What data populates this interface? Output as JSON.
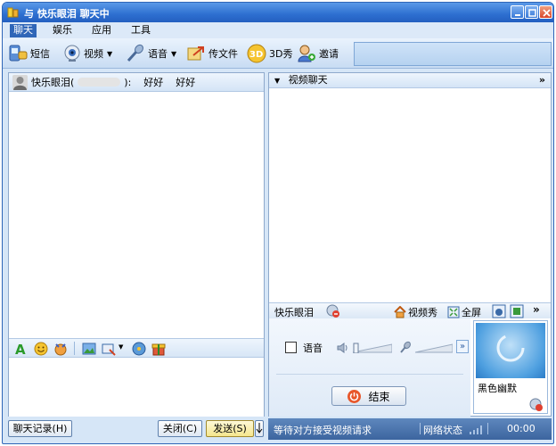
{
  "window": {
    "title": "与  快乐眼泪  聊天中"
  },
  "menu": [
    {
      "label": "聊天",
      "active": true
    },
    {
      "label": "娱乐"
    },
    {
      "label": "应用"
    },
    {
      "label": "工具"
    }
  ],
  "toolbar": {
    "sms": "短信",
    "video": "视频",
    "voice": "语音",
    "file": "传文件",
    "show3d": "3D秀",
    "invite": "邀请"
  },
  "chat": {
    "contact_name": "快乐眼泪",
    "paren_open": "(",
    "paren_close": "):",
    "message_1": "好好",
    "message_2": "好好"
  },
  "buttons": {
    "history": "聊天记录(H)",
    "close": "关闭(C)",
    "send": "发送(S)"
  },
  "video": {
    "header": "视频聊天",
    "peer_name": "快乐眼泪",
    "video_show": "视频秀",
    "fullscreen": "全屏",
    "voice_label": "语音",
    "end_call": "结束",
    "self_name": "黑色幽默"
  },
  "status": {
    "message": "等待对方接受视频请求",
    "network": "网络状态",
    "time": "00:00"
  },
  "colors": {
    "title_bar": "#2d6fd0",
    "status_bar": "#3c659f",
    "end_icon": "#e8572b"
  }
}
